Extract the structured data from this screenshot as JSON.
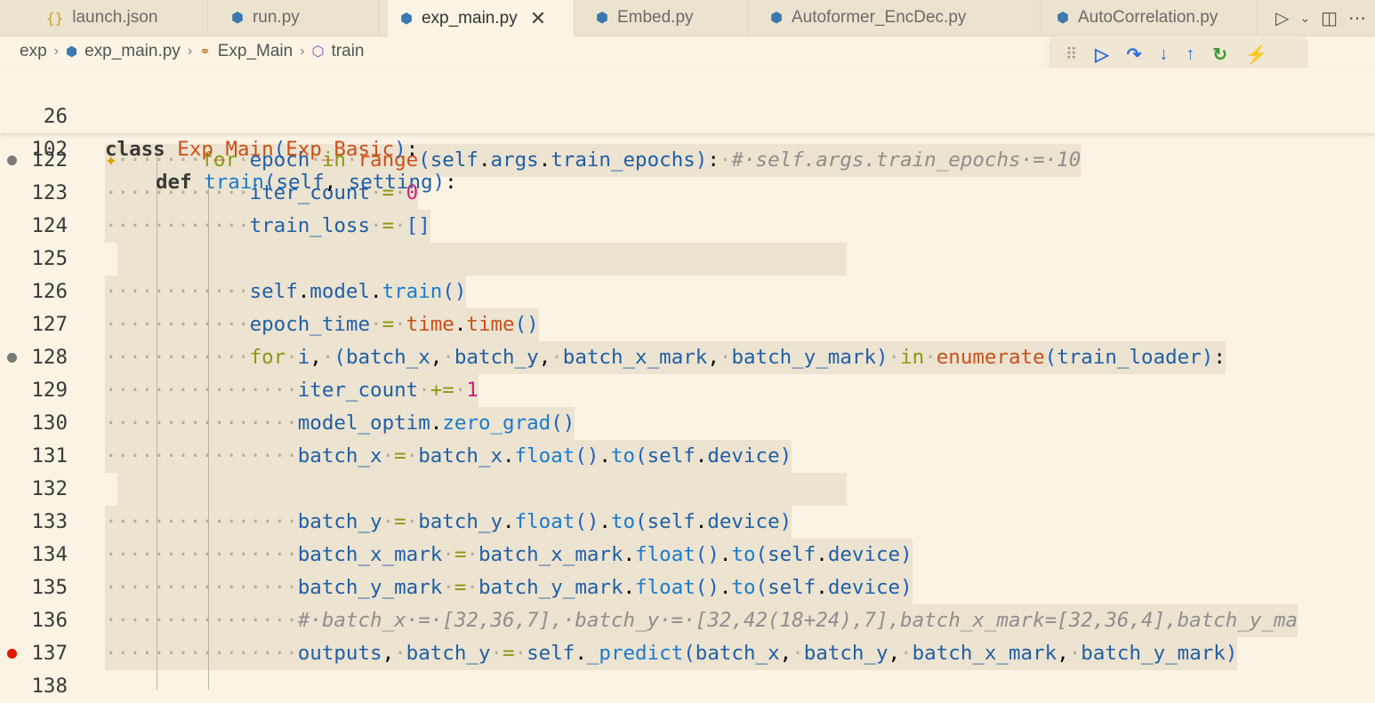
{
  "tabs": [
    {
      "label": "launch.json",
      "icon": "json-icon",
      "active": false
    },
    {
      "label": "run.py",
      "icon": "python-icon",
      "active": false
    },
    {
      "label": "exp_main.py",
      "icon": "python-icon",
      "active": true
    },
    {
      "label": "Embed.py",
      "icon": "python-icon",
      "active": false
    },
    {
      "label": "Autoformer_EncDec.py",
      "icon": "python-icon",
      "active": false
    },
    {
      "label": "AutoCorrelation.py",
      "icon": "python-icon",
      "active": false
    }
  ],
  "breadcrumb": {
    "folder": "exp",
    "file": "exp_main.py",
    "class": "Exp_Main",
    "method": "train"
  },
  "sticky": [
    {
      "ln": "26",
      "text": "class Exp_Main(Exp_Basic):"
    },
    {
      "ln": "102",
      "text": "def train(self, setting):"
    }
  ],
  "lines": [
    {
      "ln": "122",
      "text": "for epoch in range(self.args.train_epochs): # self.args.train_epochs = 10",
      "bp": "gray"
    },
    {
      "ln": "123",
      "text": "iter_count = 0"
    },
    {
      "ln": "124",
      "text": "train_loss = []"
    },
    {
      "ln": "125",
      "text": ""
    },
    {
      "ln": "126",
      "text": "self.model.train()"
    },
    {
      "ln": "127",
      "text": "epoch_time = time.time()"
    },
    {
      "ln": "128",
      "text": "for i, (batch_x, batch_y, batch_x_mark, batch_y_mark) in enumerate(train_loader):",
      "bp": "gray"
    },
    {
      "ln": "129",
      "text": "iter_count += 1"
    },
    {
      "ln": "130",
      "text": "model_optim.zero_grad()"
    },
    {
      "ln": "131",
      "text": "batch_x = batch_x.float().to(self.device)"
    },
    {
      "ln": "132",
      "text": ""
    },
    {
      "ln": "133",
      "text": "batch_y = batch_y.float().to(self.device)"
    },
    {
      "ln": "134",
      "text": "batch_x_mark = batch_x_mark.float().to(self.device)"
    },
    {
      "ln": "135",
      "text": "batch_y_mark = batch_y_mark.float().to(self.device)"
    },
    {
      "ln": "136",
      "text": "# batch_x = [32,36,7], batch_y = [32,42(18+24),7],batch_x_mark=[32,36,4],batch_y_ma"
    },
    {
      "ln": "137",
      "text": "outputs, batch_y = self._predict(batch_x, batch_y, batch_x_mark, batch_y_mark)",
      "bp": "red"
    },
    {
      "ln": "138",
      "text": ""
    }
  ],
  "debug_toolbar": [
    "grip-icon",
    "continue-icon",
    "step-over-icon",
    "step-into-icon",
    "step-out-icon",
    "restart-icon",
    "disconnect-icon"
  ],
  "colors": {
    "breakpoint": "#e51400",
    "keyword_green": "#8a9a13",
    "class_orange": "#c9501a",
    "function_blue": "#1a7ccf"
  }
}
